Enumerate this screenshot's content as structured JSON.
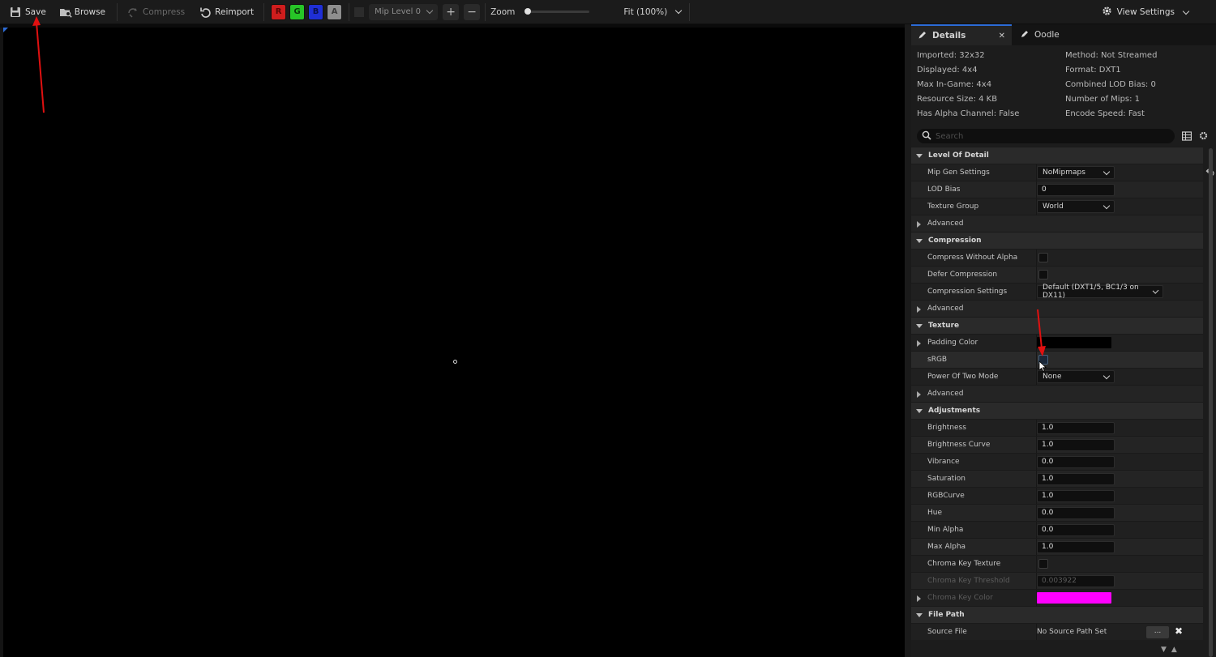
{
  "toolbar": {
    "save": "Save",
    "browse": "Browse",
    "compress": "Compress",
    "reimport": "Reimport",
    "channels": {
      "r": "R",
      "g": "G",
      "b": "B",
      "a": "A"
    },
    "mip_level": "Mip Level 0",
    "zoom_label": "Zoom",
    "zoom_fit": "Fit (100%)",
    "zoom_level": 0,
    "view_settings": "View Settings"
  },
  "tabs": [
    {
      "label": "Details",
      "active": true
    },
    {
      "label": "Oodle",
      "active": false
    }
  ],
  "info_left": [
    "Imported: 32x32",
    "Displayed: 4x4",
    "Max In-Game: 4x4",
    "Resource Size: 4 KB",
    "Has Alpha Channel: False"
  ],
  "info_right": [
    "Method: Not Streamed",
    "Format: DXT1",
    "Combined LOD Bias: 0",
    "Number of Mips: 1",
    "Encode Speed: Fast"
  ],
  "search": {
    "placeholder": "Search"
  },
  "sections": {
    "lod": {
      "title": "Level Of Detail",
      "mip_gen_settings": {
        "label": "Mip Gen Settings",
        "value": "NoMipmaps"
      },
      "lod_bias": {
        "label": "LOD Bias",
        "value": "0"
      },
      "texture_group": {
        "label": "Texture Group",
        "value": "World"
      },
      "advanced": "Advanced"
    },
    "compression": {
      "title": "Compression",
      "compress_without_alpha": "Compress Without Alpha",
      "defer_compression": "Defer Compression",
      "compression_settings": {
        "label": "Compression Settings",
        "value": "Default (DXT1/5, BC1/3 on DX11)"
      },
      "advanced": "Advanced"
    },
    "texture": {
      "title": "Texture",
      "padding_color": "Padding Color",
      "srgb": "sRGB",
      "power_of_two_mode": {
        "label": "Power Of Two Mode",
        "value": "None"
      },
      "advanced": "Advanced"
    },
    "adjustments": {
      "title": "Adjustments",
      "brightness": {
        "label": "Brightness",
        "value": "1.0"
      },
      "brightness_curve": {
        "label": "Brightness Curve",
        "value": "1.0"
      },
      "vibrance": {
        "label": "Vibrance",
        "value": "0.0"
      },
      "saturation": {
        "label": "Saturation",
        "value": "1.0"
      },
      "rgb_curve": {
        "label": "RGBCurve",
        "value": "1.0"
      },
      "hue": {
        "label": "Hue",
        "value": "0.0"
      },
      "min_alpha": {
        "label": "Min Alpha",
        "value": "0.0"
      },
      "max_alpha": {
        "label": "Max Alpha",
        "value": "1.0"
      },
      "chroma_key_texture": "Chroma Key Texture",
      "chroma_key_threshold": {
        "label": "Chroma Key Threshold",
        "value": "0.003922"
      },
      "chroma_key_color": "Chroma Key Color"
    },
    "file_path": {
      "title": "File Path",
      "source_file": {
        "label": "Source File",
        "value": "No Source Path Set"
      },
      "browse_label": "...",
      "clear_label": "✖"
    }
  },
  "colors": {
    "padding_color": "#000000",
    "chroma_key_color": "#ff00ff",
    "accent": "#2c6bd6",
    "annotation_arrow": "#e01010"
  },
  "icons": {
    "save": "save-icon",
    "browse": "browse-icon",
    "compress": "compress-icon",
    "reimport": "reimport-icon",
    "view_settings": "gear-icon",
    "details_tab": "pencil-icon",
    "oodle_tab": "pencil-icon",
    "search": "search-icon",
    "reset": "reset-arrow-icon"
  }
}
